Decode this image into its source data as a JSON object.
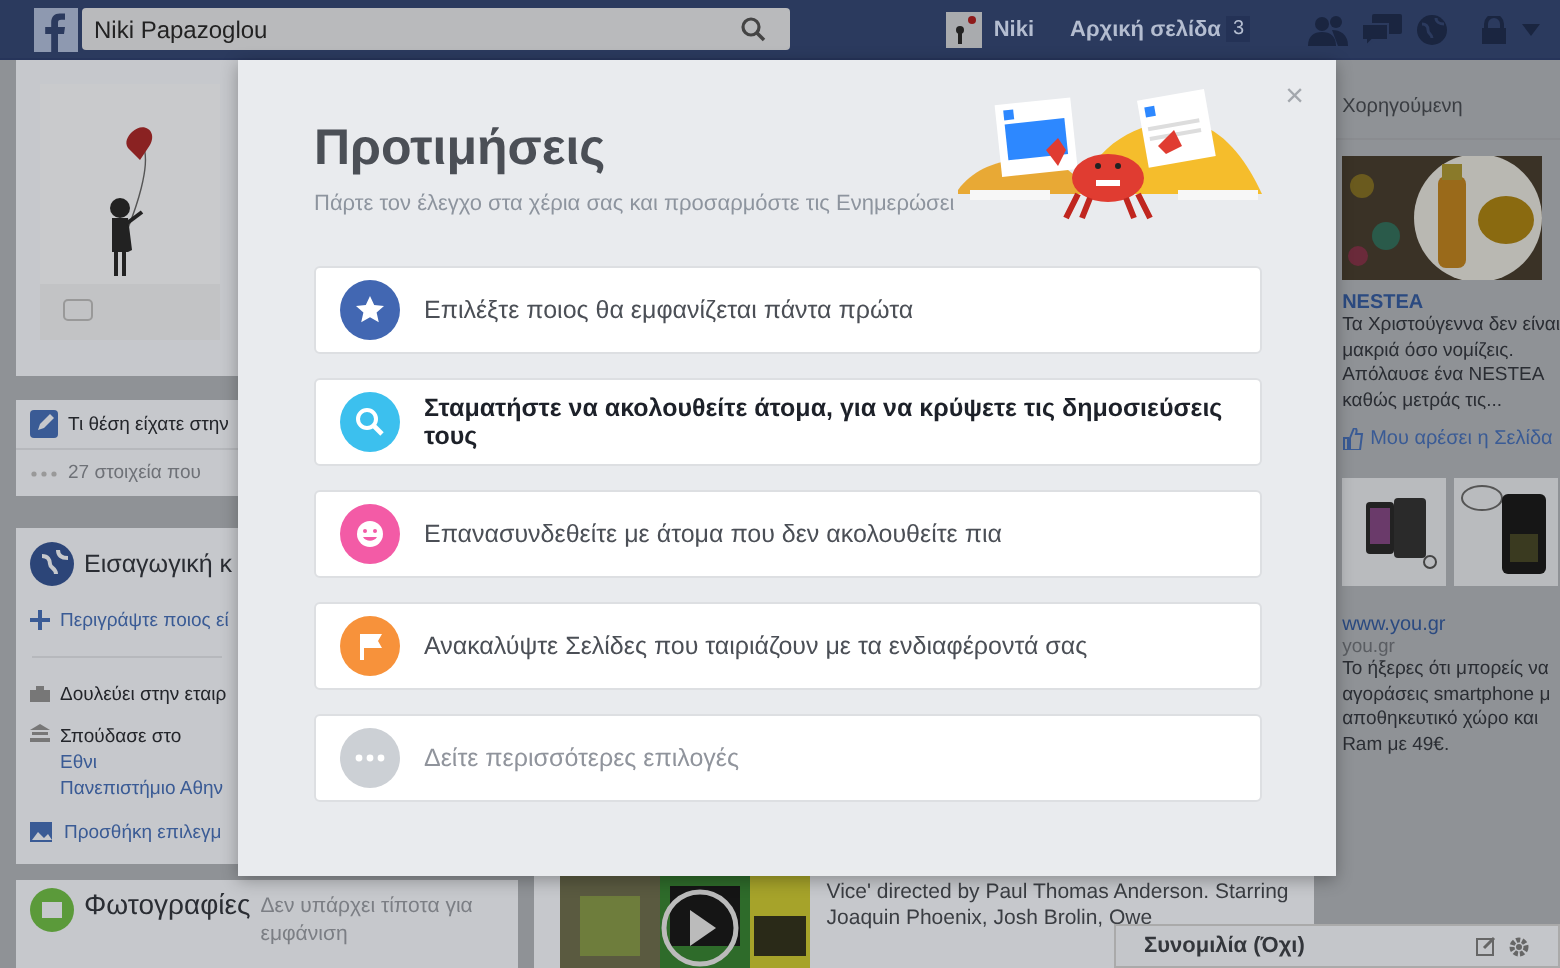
{
  "topbar": {
    "search": {
      "value": "Niki Papazoglou"
    },
    "user_name": "Niki",
    "home_link": "Αρχική σελίδα",
    "home_badge": "3"
  },
  "left": {
    "status_prompt": "Τι θέση είχατε στην",
    "items_count": "27 στοιχεία που",
    "intro": {
      "title": "Εισαγωγική κ",
      "describe_link": "Περιγράψτε ποιος εί",
      "work": "Δουλεύει στην εταιρ",
      "studied_text": "Σπούδασε στο",
      "studied_links": [
        "Εθνι",
        "Πανεπιστήμιο Αθην"
      ],
      "featured_link": "Προσθήκη επιλεγμ"
    },
    "photos": {
      "title": "Φωτογραφίες",
      "empty_text": "Δεν υπάρχει τίποτα για εμφάνιση"
    }
  },
  "post": {
    "lines": [
      "Vice' directed by Paul Thomas Anderson. Starring",
      "Joaquin Phoenix, Josh Brolin, Owe"
    ]
  },
  "sidebar": {
    "heading": "Χορηγούμενη",
    "ads": [
      {
        "kind": "single",
        "advertiser": "NESTEA",
        "lines": [
          "Τα Χριστούγεννα δεν είναι",
          "μακριά όσο νομίζεις.",
          "Απόλαυσε ένα NESTEA",
          "καθώς μετράς τις..."
        ],
        "like_link": "Μου αρέσει η Σελίδα"
      },
      {
        "kind": "double",
        "advertiser": "www.you.gr",
        "domain": "you.gr",
        "lines": [
          "Το ήξερες ότι μπορείς να",
          "αγοράσεις smartphone μ",
          "αποθηκευτικό χώρο και",
          "Ram με 49€."
        ]
      }
    ]
  },
  "chat": {
    "label": "Συνομιλία (Όχι)"
  },
  "modal": {
    "title": "Προτιμήσεις",
    "subtitle": "Πάρτε τον έλεγχο στα χέρια σας και προσαρμόστε τις Ενημερώσει",
    "close": "×",
    "options": [
      {
        "kind": "star",
        "color": "#4267b2",
        "label": "Επιλέξτε ποιος θα εμφανίζεται πάντα πρώτα",
        "highlighted": false
      },
      {
        "kind": "search",
        "color": "#3cc0ee",
        "label": "Σταματήστε να ακολουθείτε άτομα, για να κρύψετε τις δημοσιεύσεις τους",
        "highlighted": true
      },
      {
        "kind": "smile",
        "color": "#f35ba6",
        "label": "Επανασυνδεθείτε με άτομα που δεν ακολουθείτε πια",
        "highlighted": false
      },
      {
        "kind": "flag",
        "color": "#f7923b",
        "label": "Ανακαλύψτε Σελίδες που ταιριάζουν με τα ενδιαφέροντά σας",
        "highlighted": false
      },
      {
        "kind": "more",
        "color": "#ccd0d5",
        "label": "Δείτε περισσότερες επιλογές",
        "highlighted": false
      }
    ]
  }
}
